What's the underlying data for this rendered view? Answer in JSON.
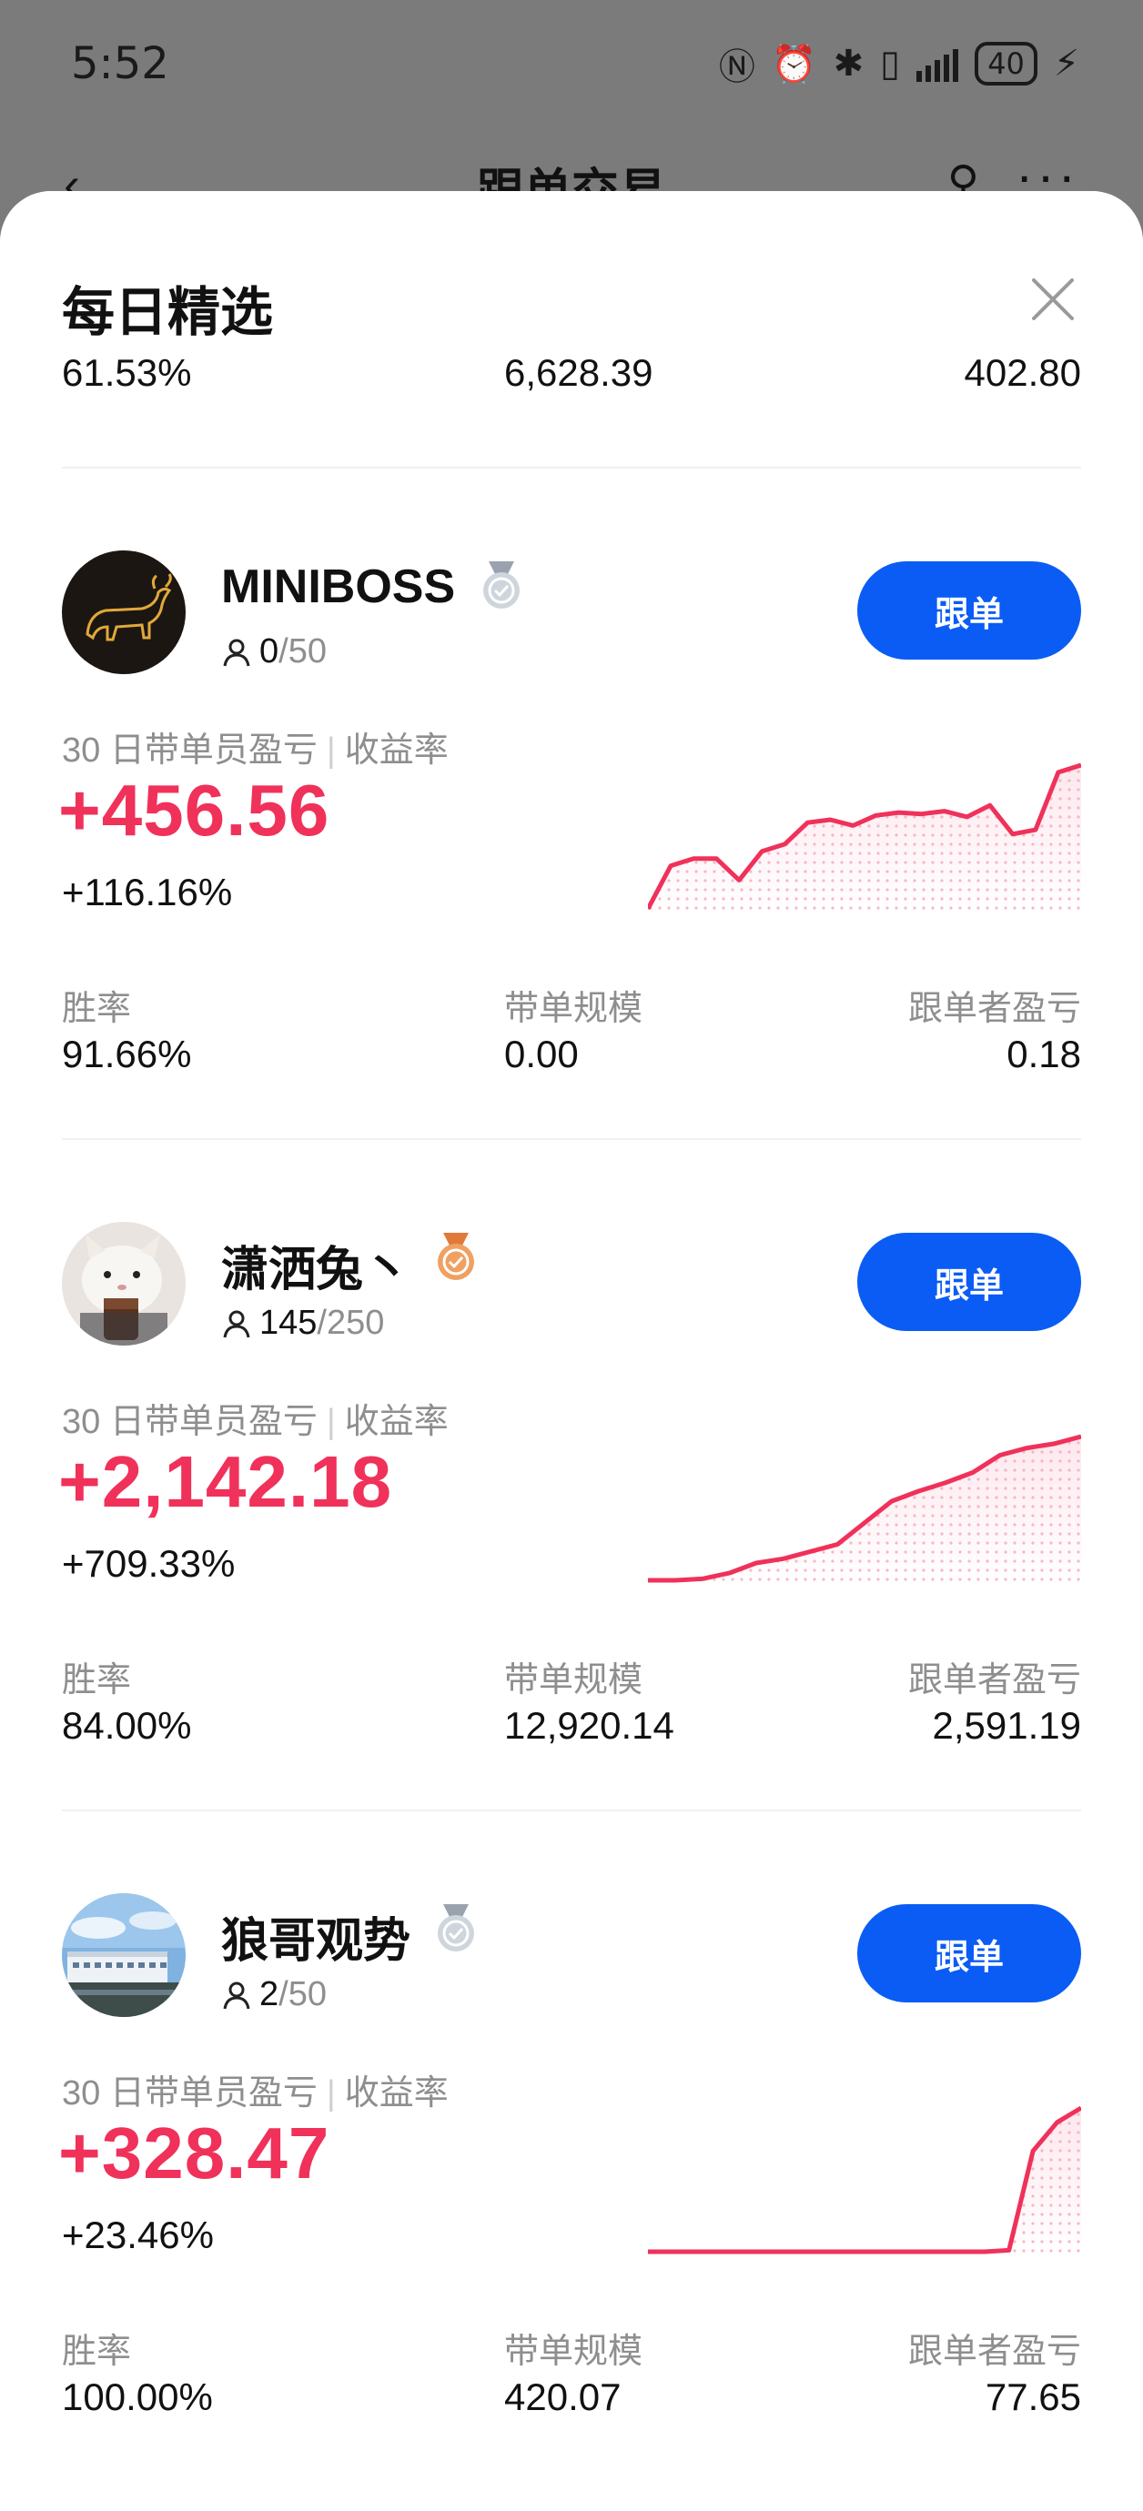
{
  "status_bar": {
    "time": "5:52",
    "battery": "40"
  },
  "app_header": {
    "title": "跟单交易"
  },
  "sheet": {
    "title": "每日精选"
  },
  "previous_card": {
    "win_rate": "61.53%",
    "scale": "6,628.39",
    "follower_pnl": "402.80"
  },
  "labels": {
    "metric": "30 日带单员盈亏",
    "metric_sep": "|",
    "roi": "收益率",
    "win_rate": "胜率",
    "scale": "带单规模",
    "follower_pnl": "跟单者盈亏",
    "follow_button": "跟单"
  },
  "colors": {
    "accent_blue": "#0a5cf5",
    "profit_red": "#f0315a"
  },
  "traders": [
    {
      "name": "MINIBOSS",
      "medal": "silver",
      "followers": "0",
      "capacity": "/50",
      "pnl": "+456.56",
      "roi": "+116.16%",
      "win_rate": "91.66%",
      "scale": "0.00",
      "follower_pnl": "0.18",
      "avatar": "bull-logo",
      "trend": [
        0,
        0.3,
        0.35,
        0.35,
        0.2,
        0.4,
        0.45,
        0.6,
        0.62,
        0.58,
        0.65,
        0.67,
        0.66,
        0.68,
        0.64,
        0.72,
        0.52,
        0.55,
        0.95,
        1.0
      ]
    },
    {
      "name": "潇洒兔丶",
      "medal": "bronze",
      "followers": "145",
      "capacity": "/250",
      "pnl": "+2,142.18",
      "roi": "+709.33%",
      "win_rate": "84.00%",
      "scale": "12,920.14",
      "follower_pnl": "2,591.19",
      "avatar": "cat-photo",
      "trend": [
        0,
        0,
        0.01,
        0.05,
        0.12,
        0.15,
        0.2,
        0.25,
        0.4,
        0.55,
        0.62,
        0.68,
        0.75,
        0.87,
        0.92,
        0.95,
        1.0
      ]
    },
    {
      "name": "狼哥观势",
      "medal": "silver",
      "followers": "2",
      "capacity": "/50",
      "pnl": "+328.47",
      "roi": "+23.46%",
      "win_rate": "100.00%",
      "scale": "420.07",
      "follower_pnl": "77.65",
      "avatar": "building-photo",
      "trend": [
        0,
        0,
        0,
        0,
        0,
        0,
        0,
        0,
        0,
        0,
        0,
        0,
        0,
        0,
        0,
        0.01,
        0.7,
        0.9,
        1.0
      ]
    }
  ]
}
